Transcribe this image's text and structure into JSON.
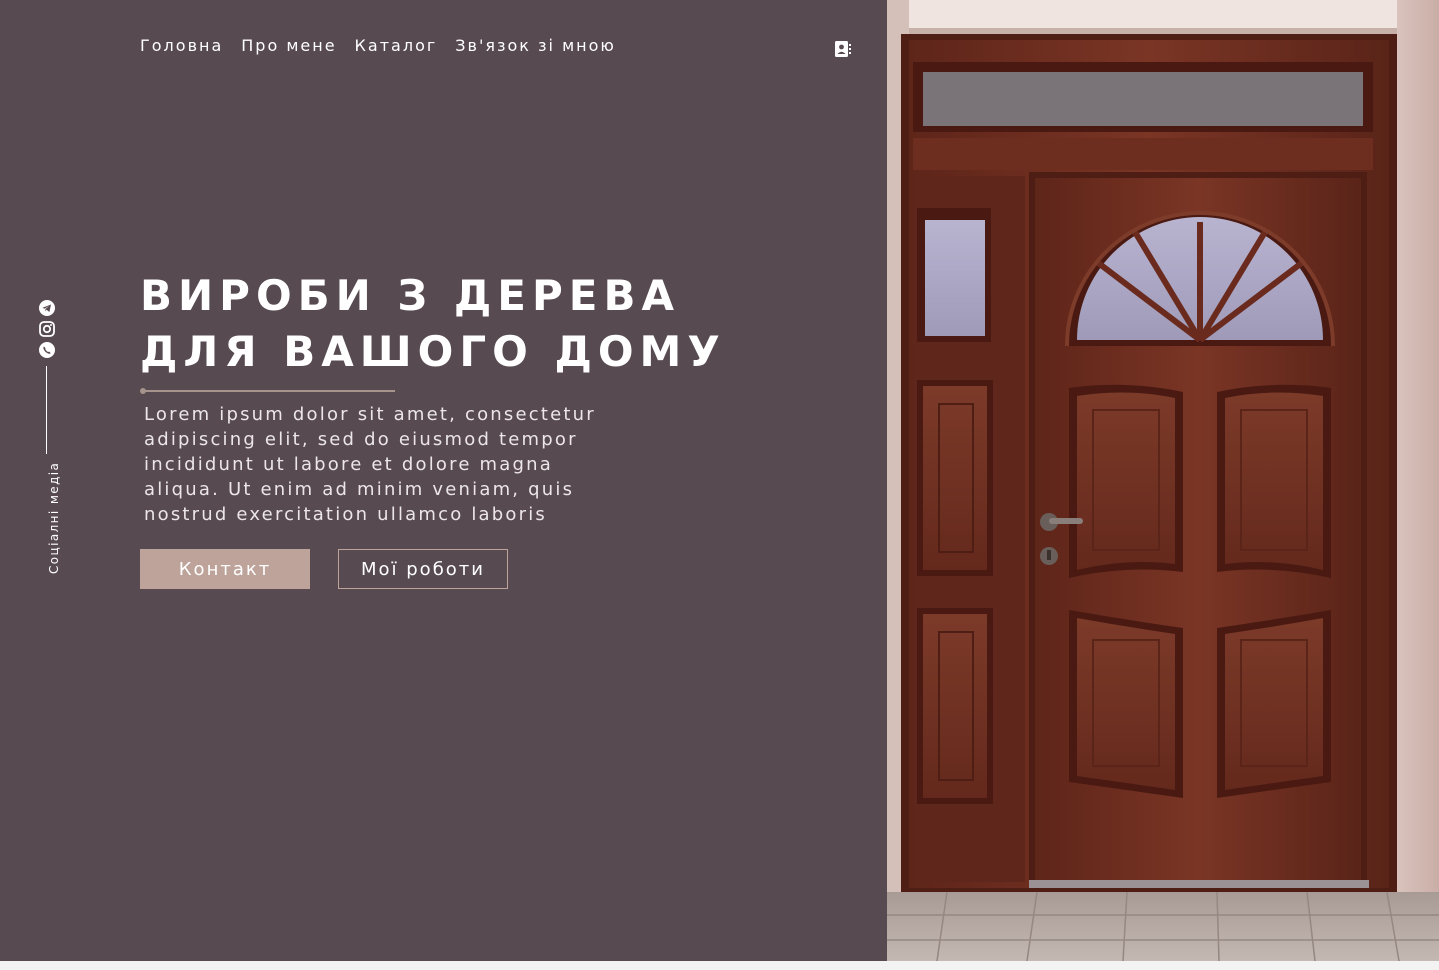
{
  "nav": {
    "items": [
      "Головна",
      "Про мене",
      "Каталог",
      "Зв'язок зі мною"
    ]
  },
  "social": {
    "label": "Соціалні медіа",
    "icons": [
      "telegram-icon",
      "instagram-icon",
      "viber-icon"
    ]
  },
  "hero": {
    "title": "ВИРОБИ З ДЕРЕВА ДЛЯ ВАШОГО ДОМУ",
    "text": "Lorem ipsum dolor sit amet, consectetur adipiscing elit, sed do eiusmod tempor incididunt ut labore et dolore magna aliqua. Ut enim ad minim veniam, quis nostrud exercitation ullamco laboris",
    "primary_button": "Контакт",
    "secondary_button": "Мої роботи"
  },
  "colors": {
    "panel": "#574a51",
    "accent": "#bda39a",
    "wood": "#6e2f22"
  }
}
